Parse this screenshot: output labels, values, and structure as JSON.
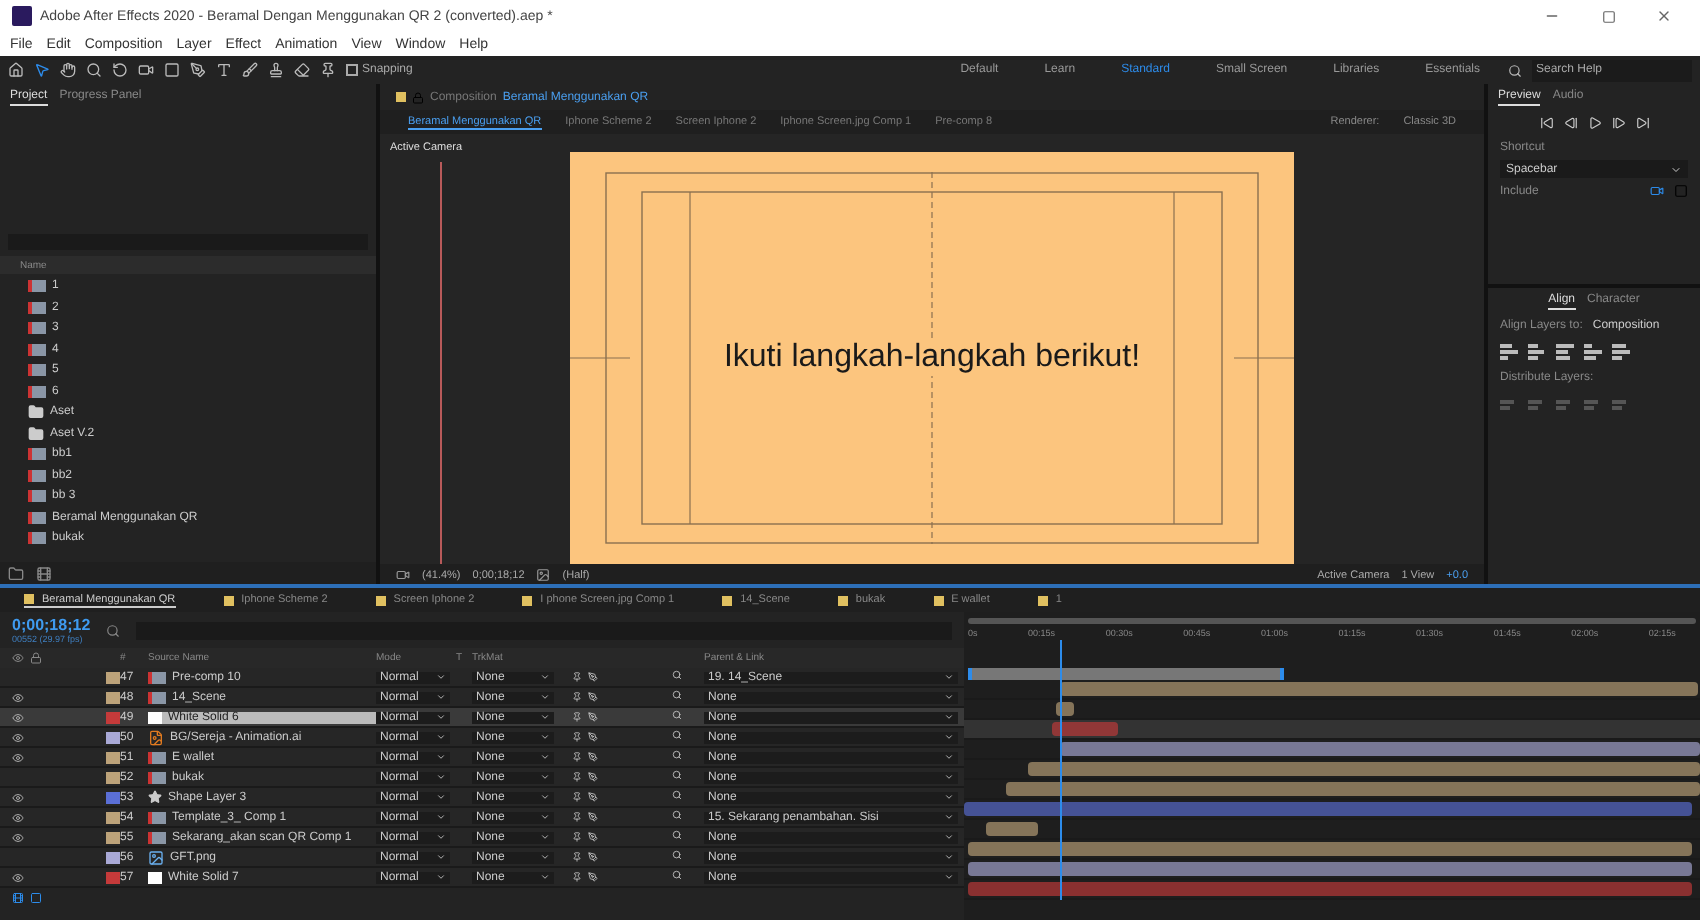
{
  "window": {
    "title": "Adobe After Effects 2020 - Beramal Dengan Menggunakan QR 2 (converted).aep *"
  },
  "menu": [
    "File",
    "Edit",
    "Composition",
    "Layer",
    "Effect",
    "Animation",
    "View",
    "Window",
    "Help"
  ],
  "toolbar": {
    "snapping": {
      "label": "Snapping",
      "checked": false
    },
    "workspaces": [
      {
        "label": "Default",
        "selected": false
      },
      {
        "label": "Learn",
        "selected": false
      },
      {
        "label": "Standard",
        "selected": true
      },
      {
        "label": "Small Screen",
        "selected": false
      },
      {
        "label": "Libraries",
        "selected": false
      },
      {
        "label": "Essentials",
        "selected": false
      }
    ],
    "search": {
      "placeholder": "Search Help"
    }
  },
  "project_panel": {
    "tabs": [
      {
        "label": "Project",
        "selected": true
      },
      {
        "label": "Progress Panel",
        "selected": false
      }
    ],
    "column": "Name",
    "items": [
      {
        "name": "1",
        "kind": "comp"
      },
      {
        "name": "2",
        "kind": "comp"
      },
      {
        "name": "3",
        "kind": "comp"
      },
      {
        "name": "4",
        "kind": "comp"
      },
      {
        "name": "5",
        "kind": "comp"
      },
      {
        "name": "6",
        "kind": "comp"
      },
      {
        "name": "Aset",
        "kind": "folder"
      },
      {
        "name": "Aset V.2",
        "kind": "folder"
      },
      {
        "name": "bb1",
        "kind": "comp"
      },
      {
        "name": "bb2",
        "kind": "comp"
      },
      {
        "name": "bb 3",
        "kind": "comp"
      },
      {
        "name": "Beramal Menggunakan QR",
        "kind": "comp"
      },
      {
        "name": "bukak",
        "kind": "comp"
      }
    ]
  },
  "composition": {
    "header": "Composition",
    "name": "Beramal Menggunakan QR",
    "tabs": [
      {
        "label": "Beramal Menggunakan QR",
        "selected": true
      },
      {
        "label": "Iphone Scheme 2",
        "selected": false
      },
      {
        "label": "Screen Iphone 2",
        "selected": false
      },
      {
        "label": "Iphone Screen.jpg Comp 1",
        "selected": false
      },
      {
        "label": "Pre-comp 8",
        "selected": false
      }
    ],
    "renderer_label": "Renderer:",
    "renderer": "Classic 3D",
    "camera_label": "Active Camera",
    "canvas_text": "Ikuti langkah-langkah berikut!",
    "footer": {
      "zoom": "(41.4%)",
      "time": "0;00;18;12",
      "resolution": "(Half)",
      "camera": "Active Camera",
      "views": "1 View",
      "exposure": "+0.0"
    }
  },
  "right_panel": {
    "preview_tabs": [
      {
        "label": "Preview",
        "selected": true
      },
      {
        "label": "Audio",
        "selected": false
      }
    ],
    "shortcut_label": "Shortcut",
    "shortcut": "Spacebar",
    "include_label": "Include",
    "align_tabs": [
      {
        "label": "Align",
        "selected": true
      },
      {
        "label": "Character",
        "selected": false
      }
    ],
    "align_to_label": "Align Layers to:",
    "align_to": "Composition",
    "distribute_label": "Distribute Layers:"
  },
  "timeline": {
    "tabs": [
      {
        "label": "Beramal Menggunakan QR",
        "selected": true
      },
      {
        "label": "Iphone Scheme 2",
        "selected": false
      },
      {
        "label": "Screen Iphone 2",
        "selected": false
      },
      {
        "label": "I phone Screen.jpg Comp 1",
        "selected": false
      },
      {
        "label": "14_Scene",
        "selected": false
      },
      {
        "label": "bukak",
        "selected": false
      },
      {
        "label": "E wallet",
        "selected": false
      },
      {
        "label": "1",
        "selected": false
      }
    ],
    "timecode": "0;00;18;12",
    "frame_info": "00552 (29.97 fps)",
    "columns": [
      "#",
      "Source Name",
      "Mode",
      "T",
      "TrkMat",
      "Parent & Link"
    ],
    "ruler": [
      "0s",
      "00:15s",
      "00:30s",
      "00:45s",
      "01:00s",
      "01:15s",
      "01:30s",
      "01:45s",
      "02:00s",
      "02:15s"
    ],
    "layers": [
      {
        "number": "47",
        "name": "Pre-comp 10",
        "kind": "comp",
        "color": "#bda37a",
        "visible": false,
        "selected": false,
        "mode": "Normal",
        "trkmat": "None",
        "parent": "19. 14_Scene"
      },
      {
        "number": "48",
        "name": "14_Scene",
        "kind": "comp",
        "color": "#bda37a",
        "visible": true,
        "selected": false,
        "mode": "Normal",
        "trkmat": "None",
        "parent": "None"
      },
      {
        "number": "49",
        "name": "White Solid 6",
        "kind": "solid",
        "color": "#c53a3a",
        "visible": true,
        "selected": true,
        "mode": "Normal",
        "trkmat": "None",
        "parent": "None"
      },
      {
        "number": "50",
        "name": "BG/Sereja - Animation.ai",
        "kind": "ai",
        "color": "#a9a9d6",
        "visible": true,
        "selected": false,
        "mode": "Normal",
        "trkmat": "None",
        "parent": "None"
      },
      {
        "number": "51",
        "name": "E wallet",
        "kind": "comp",
        "color": "#bda37a",
        "visible": true,
        "selected": false,
        "mode": "Normal",
        "trkmat": "None",
        "parent": "None"
      },
      {
        "number": "52",
        "name": "bukak",
        "kind": "comp",
        "color": "#bda37a",
        "visible": false,
        "selected": false,
        "mode": "Normal",
        "trkmat": "None",
        "parent": "None"
      },
      {
        "number": "53",
        "name": "Shape Layer 3",
        "kind": "shape",
        "color": "#5b6fd6",
        "visible": true,
        "selected": false,
        "mode": "Normal",
        "trkmat": "None",
        "parent": "None"
      },
      {
        "number": "54",
        "name": "Template_3_ Comp 1",
        "kind": "comp",
        "color": "#bda37a",
        "visible": true,
        "selected": false,
        "mode": "Normal",
        "trkmat": "None",
        "parent": "15. Sekarang penambahan. Sisi"
      },
      {
        "number": "55",
        "name": "Sekarang_akan scan QR Comp 1",
        "kind": "comp",
        "color": "#bda37a",
        "visible": true,
        "selected": false,
        "mode": "Normal",
        "trkmat": "None",
        "parent": "None"
      },
      {
        "number": "56",
        "name": "GFT.png",
        "kind": "image",
        "color": "#a9a9d6",
        "visible": false,
        "selected": false,
        "mode": "Normal",
        "trkmat": "None",
        "parent": "None"
      },
      {
        "number": "57",
        "name": "White Solid 7",
        "kind": "solid",
        "color": "#c53a3a",
        "visible": true,
        "selected": false,
        "mode": "Normal",
        "trkmat": "None",
        "parent": "None"
      }
    ]
  }
}
